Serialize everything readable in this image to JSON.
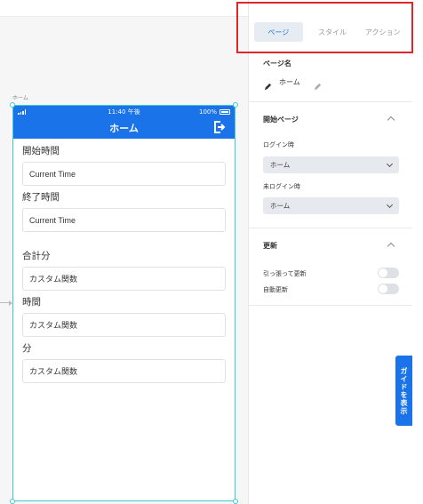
{
  "canvas": {
    "screen_label": "ホーム"
  },
  "phone": {
    "status_time": "11:40 午後",
    "battery": "100%",
    "header_title": "ホーム",
    "fields": [
      {
        "label": "開始時間",
        "value": "Current Time"
      },
      {
        "label": "終了時間",
        "value": "Current Time"
      },
      {
        "label": "合計分",
        "value": "カスタム関数"
      },
      {
        "label": "時間",
        "value": "カスタム関数"
      },
      {
        "label": "分",
        "value": "カスタム関数"
      }
    ]
  },
  "panel": {
    "tabs": {
      "page": "ページ",
      "style": "スタイル",
      "action": "アクション"
    },
    "page_name": {
      "title": "ページ名",
      "value": "ホーム"
    },
    "start_page": {
      "title": "開始ページ",
      "logged_in_label": "ログイン時",
      "logged_in_value": "ホーム",
      "logged_out_label": "未ログイン時",
      "logged_out_value": "ホーム"
    },
    "refresh": {
      "title": "更新",
      "pull_to_refresh": "引っ張って更新",
      "auto_refresh": "自動更新"
    },
    "guide_button": "ガイドを表示"
  },
  "colors": {
    "accent": "#1a73e8",
    "highlight": "#e0262b",
    "selection": "#3ec9d6"
  }
}
